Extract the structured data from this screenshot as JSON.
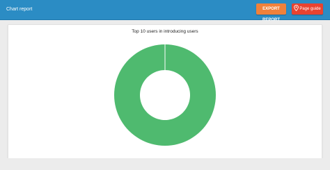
{
  "header": {
    "title": "Chart report",
    "export_label": "EXPORT REPORT",
    "guide_label": "Page guide"
  },
  "colors": {
    "header_bg": "#2b8cc4",
    "export_bg": "#f0813a",
    "guide_bg": "#e8432f",
    "slice": "#4fba6f"
  },
  "icons": {
    "guide": "map-pin-icon"
  },
  "chart_data": {
    "type": "pie",
    "title": "Top 10 users in introducing users",
    "series": [
      {
        "values": [
          1
        ]
      }
    ]
  }
}
